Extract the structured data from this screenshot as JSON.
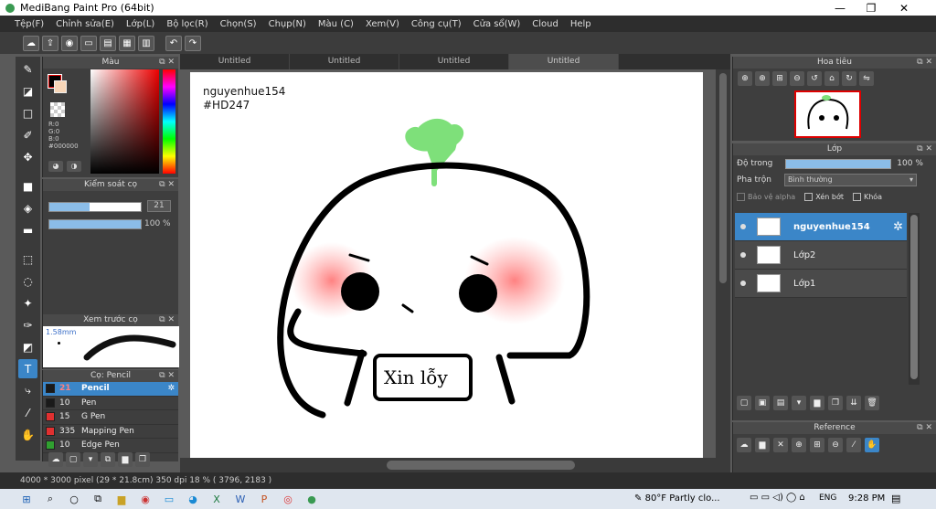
{
  "window": {
    "title": "MediBang Paint Pro (64bit)",
    "minimize": "—",
    "maximize": "❐",
    "close": "✕"
  },
  "menu": [
    "Tệp(F)",
    "Chỉnh sửa(E)",
    "Lớp(L)",
    "Bộ lọc(R)",
    "Chọn(S)",
    "Chụp(N)",
    "Màu (C)",
    "Xem(V)",
    "Công cụ(T)",
    "Cửa sổ(W)",
    "Cloud",
    "Help"
  ],
  "color_panel": {
    "title": "Màu",
    "rgb": [
      "R:0",
      "G:0",
      "B:0",
      "#000000"
    ]
  },
  "brush_control": {
    "title": "Kiểm soát cọ",
    "size_value": "21",
    "size_fraction": 0.44,
    "opacity_label": "100 %",
    "opacity_fraction": 1.0
  },
  "brush_preview": {
    "title": "Xem trước cọ",
    "size_label": "1.58mm"
  },
  "brush_list": {
    "title": "Cọ: Pencil",
    "items": [
      {
        "size": "21",
        "name": "Pencil",
        "color": "#1a1a1a",
        "selected": true
      },
      {
        "size": "10",
        "name": "Pen",
        "color": "#1a1a1a",
        "selected": false
      },
      {
        "size": "15",
        "name": "G Pen",
        "color": "#e03030",
        "selected": false
      },
      {
        "size": "335",
        "name": "Mapping Pen",
        "color": "#e03030",
        "selected": false
      },
      {
        "size": "10",
        "name": "Edge Pen",
        "color": "#30a030",
        "selected": false
      }
    ]
  },
  "tabs": [
    "Untitled",
    "Untitled",
    "Untitled",
    "Untitled"
  ],
  "canvas": {
    "text1": "nguyenhue154",
    "text2": "#HD247",
    "sign": "Xin lỗy"
  },
  "status": {
    "text": "4000 * 3000 pixel  (29 * 21.8cm)  350 dpi  18 %  ( 3796, 2183 )"
  },
  "navigator": {
    "title": "Hoa tiêu"
  },
  "layers": {
    "title": "Lớp",
    "opacity_label": "Độ trong",
    "opacity_value": "100 %",
    "blend_label": "Pha trộn",
    "blend_value": "Bình thường",
    "protect_alpha": "Bảo vệ alpha",
    "clipping": "Xén bớt",
    "lock": "Khóa",
    "items": [
      {
        "name": "nguyenhue154",
        "selected": true
      },
      {
        "name": "Lớp2",
        "selected": false
      },
      {
        "name": "Lớp1",
        "selected": false
      }
    ]
  },
  "reference": {
    "title": "Reference"
  },
  "taskbar": {
    "weather": "80°F  Partly clo...",
    "lang": "ENG",
    "time": "9:28 PM"
  }
}
